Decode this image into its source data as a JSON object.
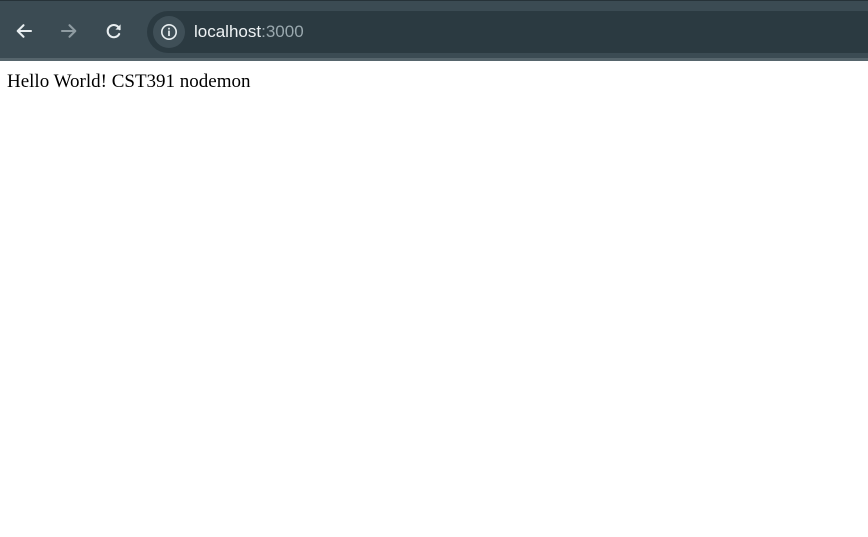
{
  "browser": {
    "address_bar": {
      "host": "localhost",
      "port": ":3000"
    },
    "icons": {
      "back": "arrow-left-icon",
      "forward": "arrow-right-icon",
      "reload": "reload-icon",
      "site_info": "info-icon"
    },
    "colors": {
      "toolbar": "#3b4b53",
      "omnibox": "#2b3a41",
      "icon": "#e8eef0",
      "icon_disabled": "#8f9ca2"
    }
  },
  "page": {
    "body_text": "Hello World! CST391 nodemon"
  }
}
